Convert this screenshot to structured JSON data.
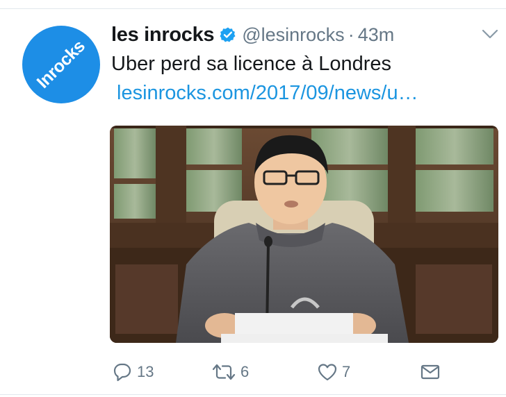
{
  "tweet": {
    "display_name": "les inrocks",
    "handle": "@lesinrocks",
    "separator": "·",
    "time": "43m",
    "text": "Uber perd sa licence à Londres",
    "link": "lesinrocks.com/2017/09/news/u…",
    "avatar_text": "Inrocks",
    "verified": true
  },
  "icons": {
    "verified": "verified-badge-icon",
    "menu": "chevron-down-icon",
    "reply": "reply-icon",
    "retweet": "retweet-icon",
    "like": "heart-icon",
    "message": "envelope-icon"
  },
  "actions": {
    "reply_count": "13",
    "retweet_count": "6",
    "like_count": "7"
  },
  "colors": {
    "brand_blue": "#1d8ee6",
    "link_blue": "#1b95e0",
    "secondary_text": "#657786",
    "primary_text": "#14171a"
  }
}
